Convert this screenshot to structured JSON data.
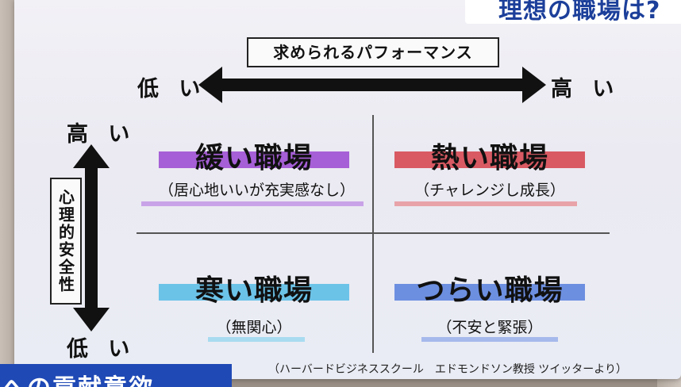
{
  "header": {
    "title": "理想の職場は?"
  },
  "x_axis": {
    "label": "求められるパフォーマンス",
    "low": "低 い",
    "high": "高 い"
  },
  "y_axis": {
    "label": "心理的安全性",
    "high": "高 い",
    "low": "低 い"
  },
  "quadrants": [
    {
      "name": "緩い職場",
      "desc": "（居心地いいが充実感なし）",
      "color": "#a65fd6",
      "underline_color": "#c9a3e8"
    },
    {
      "name": "熱い職場",
      "desc": "（チャレンジし成長）",
      "color": "#d95a63",
      "underline_color": "#e8a3a9"
    },
    {
      "name": "寒い職場",
      "desc": "（無関心）",
      "color": "#6cc3e8",
      "underline_color": "#a9dbf0"
    },
    {
      "name": "つらい職場",
      "desc": "（不安と緊張）",
      "color": "#6d8fe0",
      "underline_color": "#a6b9ec"
    }
  ],
  "source": "（ハーバードビジネススクール　エドモンドソン教授 ツイッターより）",
  "caption": {
    "text": "への貢献意欲"
  },
  "colors": {
    "caption_bg": "#1f49b5",
    "title_text": "#1c3f9a"
  }
}
